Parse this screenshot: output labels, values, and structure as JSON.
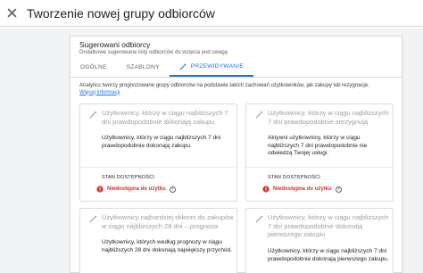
{
  "header": {
    "title": "Tworzenie nowej grupy odbiorców"
  },
  "panel": {
    "title": "Sugerowani odbiorcy",
    "subtitle": "Dodatkowe sugerowane listy odbiorców do wzięcia pod uwagę"
  },
  "tabs": [
    {
      "label": "OGÓLNE",
      "active": false
    },
    {
      "label": "SZABLONY",
      "active": false
    },
    {
      "label": "PRZEWIDYWANIE",
      "active": true
    }
  ],
  "info": {
    "text": "Analytics tworzy prognozowane grupy odbiorców na podstawie takich zachowań użytkowników, jak zakupy lub rezygnacje.",
    "link": "Więcej informacji"
  },
  "cards": [
    {
      "title": "Użytkownicy, którzy w ciągu najbliższych 7 dni prawdopodobnie dokonają zakupu",
      "desc": "Użytkownicy, którzy w ciągu najbliższych 7 dni prawdopodobnie dokonają zakupu.",
      "status_label": "STAN DOSTĘPNOŚCI",
      "status": "Niedostępna do użytku"
    },
    {
      "title": "Użytkownicy, którzy w ciągu najbliższych 7 dni prawdopodobnie zrezygnują",
      "desc": "Aktywni użytkownicy, którzy w ciągu najbliższych 7 dni prawdopodobnie nie odwiedzą Twojej usługi.",
      "status_label": "STAN DOSTĘPNOŚCI",
      "status": "Niedostępna do użytku"
    },
    {
      "title": "Użytkownicy najbardziej skłonni do zakupów w ciągu najbliższych 28 dni – prognoza",
      "desc": "Użytkownicy, których według prognozy w ciągu najbliższych 28 dni dokonają największy przychód."
    },
    {
      "title": "Użytkownicy, którzy w ciągu najbliższych 7 dni prawdopodobnie dokonają pierwszego zakupu",
      "desc": "Użytkownicy, którzy w ciągu najbliższych 7 dni prawdopodobnie dokonają pierwszego zakupu."
    }
  ],
  "icons": {
    "close": "close-icon",
    "wand": "magic-wand-icon",
    "error": "error-icon",
    "help": "help-icon"
  },
  "colors": {
    "accent": "#1a73e8",
    "error": "#d93025",
    "background": "#f1f3f4"
  }
}
